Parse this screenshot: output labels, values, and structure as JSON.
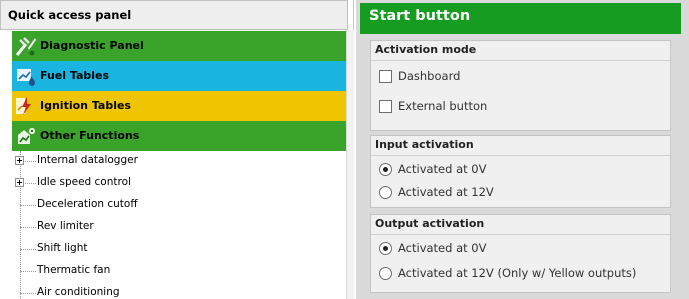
{
  "quick_access": {
    "title": "Quick access panel",
    "categories": [
      {
        "label": "Diagnostic Panel",
        "icon": "diagnostic-icon",
        "color": "#3aa329"
      },
      {
        "label": "Fuel Tables",
        "icon": "fuel-icon",
        "color": "#1ab4e0"
      },
      {
        "label": "Ignition Tables",
        "icon": "ignition-icon",
        "color": "#efc400"
      },
      {
        "label": "Other Functions",
        "icon": "other-functions-icon",
        "color": "#3aa329"
      }
    ],
    "tree_items": [
      {
        "label": "Internal datalogger",
        "expandable": true
      },
      {
        "label": "Idle speed control",
        "expandable": true
      },
      {
        "label": "Deceleration cutoff",
        "expandable": false
      },
      {
        "label": "Rev limiter",
        "expandable": false
      },
      {
        "label": "Shift light",
        "expandable": false
      },
      {
        "label": "Thermatic fan",
        "expandable": false
      },
      {
        "label": "Air conditioning",
        "expandable": false
      }
    ]
  },
  "start_button": {
    "title": "Start button",
    "header_color": "#169c20",
    "activation_mode": {
      "title": "Activation mode",
      "options": [
        {
          "label": "Dashboard",
          "checked": false
        },
        {
          "label": "External button",
          "checked": false
        }
      ]
    },
    "input_activation": {
      "title": "Input activation",
      "options": [
        {
          "label": "Activated at 0V",
          "selected": true
        },
        {
          "label": "Activated at 12V",
          "selected": false
        }
      ]
    },
    "output_activation": {
      "title": "Output activation",
      "options": [
        {
          "label": "Activated at 0V",
          "selected": true
        },
        {
          "label": "Activated at 12V (Only w/ Yellow outputs)",
          "selected": false
        }
      ]
    }
  }
}
